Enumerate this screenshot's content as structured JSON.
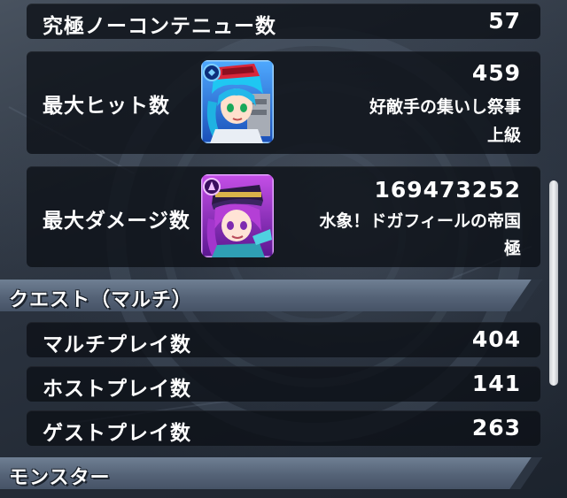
{
  "quest_single": {
    "rows": [
      {
        "label": "究極ノーコンテニュー数",
        "value": "57"
      }
    ]
  },
  "max_hit": {
    "label": "最大ヒット数",
    "value": "459",
    "quest_name": "好敵手の集いし祭事",
    "difficulty": "上級",
    "avatar_icon": "blue-haired-character-avatar"
  },
  "max_damage": {
    "label": "最大ダメージ数",
    "value": "169473252",
    "quest_name": "水象！ドガフィールの帝国",
    "difficulty": "極",
    "avatar_icon": "purple-haired-character-avatar"
  },
  "section_multi": {
    "title": "クエスト（マルチ）",
    "rows": [
      {
        "label": "マルチプレイ数",
        "value": "404"
      },
      {
        "label": "ホストプレイ数",
        "value": "141"
      },
      {
        "label": "ゲストプレイ数",
        "value": "263"
      }
    ]
  },
  "section_monster": {
    "title": "モンスター"
  },
  "colors": {
    "row_background": "#0c1016",
    "section_band": "#5f6e82",
    "text": "#ffffff"
  }
}
